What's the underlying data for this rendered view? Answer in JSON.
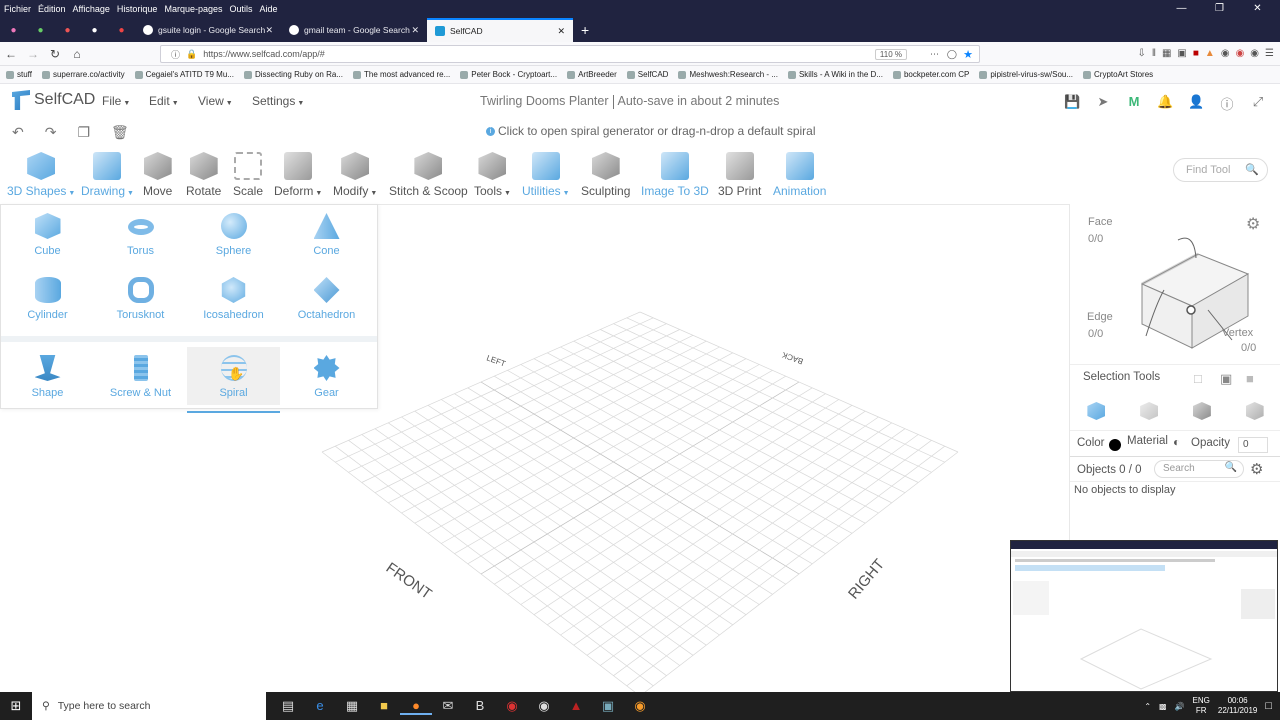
{
  "firefox": {
    "menu": [
      "Fichier",
      "Édition",
      "Affichage",
      "Historique",
      "Marque-pages",
      "Outils",
      "Aide"
    ],
    "tabs": [
      {
        "label": "gsuite login - Google Search"
      },
      {
        "label": "gmail team - Google Search"
      },
      {
        "label": "SelfCAD"
      }
    ],
    "url": "https://www.selfcad.com/app/#",
    "zoom": "110 %",
    "bookmarks": [
      "stuff",
      "superrare.co/activity",
      "Cegaiel's ATITD T9 Mu...",
      "Dissecting Ruby on Ra...",
      "The most advanced re...",
      "Peter Bock - Cryptoart...",
      "ArtBreeder",
      "SelfCAD",
      "Meshwesh:Research - ...",
      "Skills - A Wiki in the D...",
      "bockpeter.com CP",
      "pipistrel-virus-sw/Sou...",
      "CryptoArt Stores"
    ]
  },
  "app": {
    "logo": "SelfCAD",
    "menus": [
      "File",
      "Edit",
      "View",
      "Settings"
    ],
    "doc_title": "Twirling Dooms Planter",
    "autosave": "Auto-save in about 2 minutes",
    "hint": "Click to open spiral generator or drag-n-drop a default spiral"
  },
  "ribbon": {
    "tools": [
      "3D Shapes",
      "Drawing",
      "Move",
      "Rotate",
      "Scale",
      "Deform",
      "Modify",
      "Stitch & Scoop",
      "Tools",
      "Utilities",
      "Sculpting",
      "Image To 3D",
      "3D Print",
      "Animation"
    ],
    "find_placeholder": "Find Tool"
  },
  "shapes": {
    "basic": [
      "Cube",
      "Torus",
      "Sphere",
      "Cone",
      "Cylinder",
      "Torusknot",
      "Icosahedron",
      "Octahedron"
    ],
    "generators": [
      "Shape",
      "Screw & Nut",
      "Spiral",
      "Gear"
    ],
    "active": "Spiral"
  },
  "viewport": {
    "labels": {
      "left": "LEFT",
      "back": "BACK",
      "front": "FRONT",
      "right": "RIGHT"
    }
  },
  "right_panel": {
    "face_label": "Face",
    "face_count": "0/0",
    "edge_label": "Edge",
    "edge_count": "0/0",
    "vertex_label": "Vertex",
    "vertex_count": "0/0",
    "selection_tools": "Selection Tools",
    "color_label": "Color",
    "material_label": "Material",
    "opacity_label": "Opacity",
    "opacity_value": "0",
    "objects_label": "Objects 0 / 0",
    "search_placeholder": "Search",
    "no_objects": "No objects to display"
  },
  "taskbar": {
    "search_placeholder": "Type here to search",
    "lang": "ENG",
    "locale": "FR",
    "time": "00:06",
    "date": "22/11/2019"
  },
  "colors": {
    "accent": "#5aa8e0",
    "firefox_chrome": "#202340",
    "taskbar": "#1f1f1f"
  }
}
